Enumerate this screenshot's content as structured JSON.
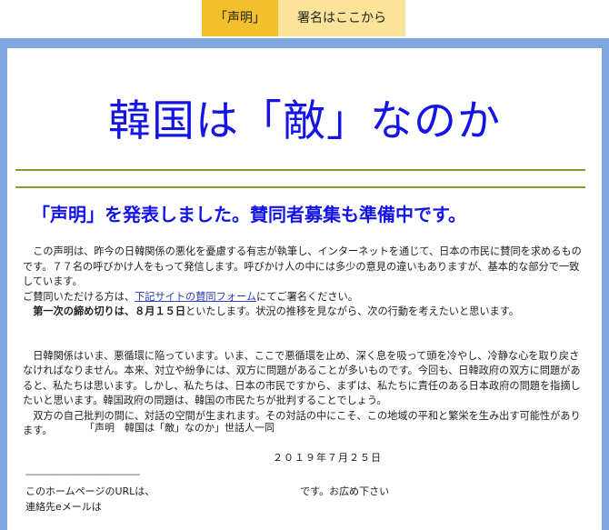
{
  "nav": {
    "tabs": [
      {
        "label": "「声明」"
      },
      {
        "label": "署名はここから"
      }
    ]
  },
  "main": {
    "title": "韓国は「敵」なのか",
    "subtitle": "「声明」を発表しました。賛同者募集も準備中です。",
    "para1": {
      "line1": "この声明は、昨今の日韓関係の悪化を憂慮する有志が執筆し、インターネットを通じて、日本の市民に賛同を求めるものです。７７名の呼びかけ人をもって発信します。呼びかけ人の中には多少の意見の違いもありますが、基本的な部分で一致しています。",
      "line2_pre": "ご賛同いただける方は、",
      "line2_link": "下記サイトの賛同フォーム",
      "line2_post": "にてご署名ください。",
      "deadline_bold": "第一次の締め切りは、８月１５日",
      "deadline_rest": "といたします。状況の推移を見ながら、次の行動を考えたいと思います。"
    },
    "para2": {
      "text": "日韓関係はいま、悪循環に陥っています。いま、ここで悪循環を止め、深く息を吸って頭を冷やし、冷静な心を取り戻さなければなりません。本来、対立や紛争には、双方に問題があることが多いものです。今回も、日韓政府の双方に問題があると、私たちは思います。しかし、私たちは、日本の市民ですから、まずは、私たちに責任のある日本政府の問題を指摘したいと思います。韓国政府の問題は、韓国の市民たちが批判することでしょう。",
      "text2": "双方の自己批判の間に、対話の空間が生まれます。その対話の中にこそ、この地域の平和と繁栄を生み出す可能性があります。"
    },
    "signature": "「声明　韓国は「敵」なのか」世話人一同",
    "date": "２０１９年７月２５日",
    "divider": "------------------------------------------------",
    "url_label": "このホームページのURLは、",
    "url_suffix": "です。お広め下さい",
    "email_label": "連絡先eメールは"
  },
  "colors": {
    "accent_tab": "#f2c02a",
    "tab_light": "#fbe39a",
    "frame": "#7fa7e0",
    "title": "#1414e6",
    "rule": "#8a9a2e"
  }
}
